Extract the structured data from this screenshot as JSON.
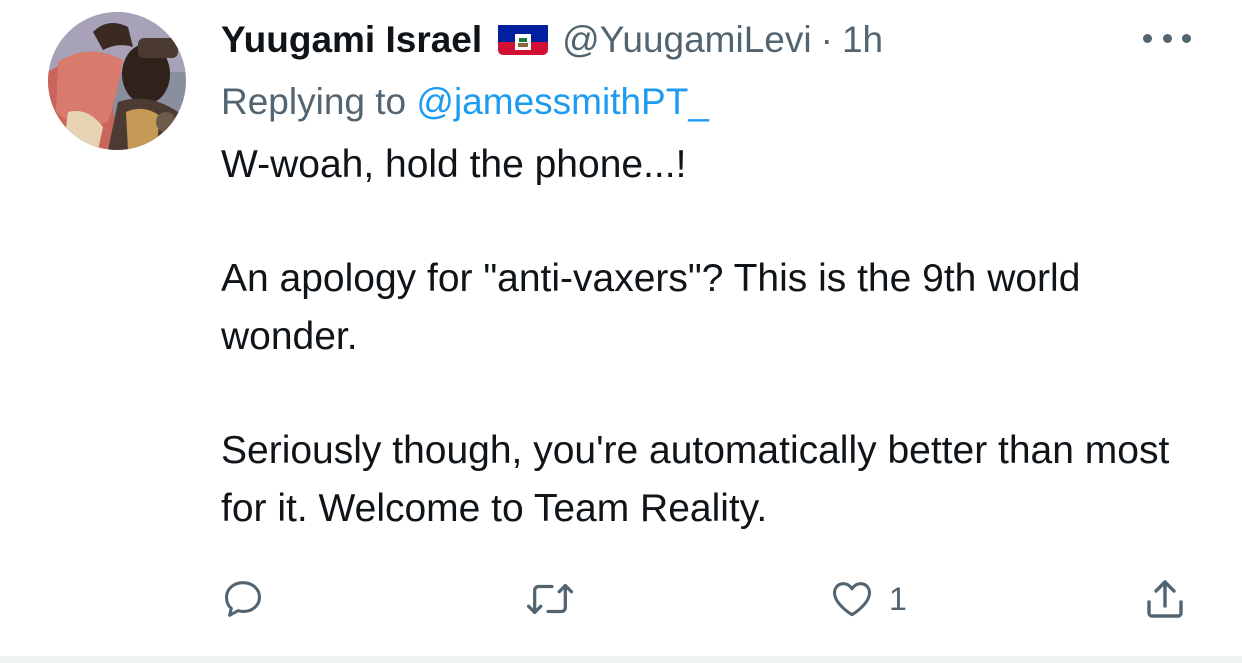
{
  "tweet": {
    "author": {
      "display_name": "Yuugami Israel",
      "handle": "@YuugamiLevi",
      "separator": "·",
      "time": "1h",
      "flag_icon": "haiti-flag-emoji"
    },
    "reply_prefix": "Replying to",
    "reply_mention": "@jamessmithPT_",
    "paragraphs": [
      "W-woah, hold the phone...!",
      "An apology for \"anti-vaxers\"? This is the 9th world wonder.",
      "Seriously though, you're automatically better than most for it. Welcome to Team Reality."
    ],
    "actions": {
      "reply_icon": "speech-bubble-icon",
      "retweet_icon": "retweet-arrows-icon",
      "like_icon": "heart-outline-icon",
      "like_count": "1",
      "share_icon": "share-upload-icon",
      "more_icon": "more-horizontal-icon"
    }
  },
  "colors": {
    "text": "#0f1419",
    "secondary": "#536471",
    "link": "#1d9bf0",
    "divider": "#eff3f4",
    "flag_blue": "#00209f",
    "flag_red": "#d21034"
  }
}
